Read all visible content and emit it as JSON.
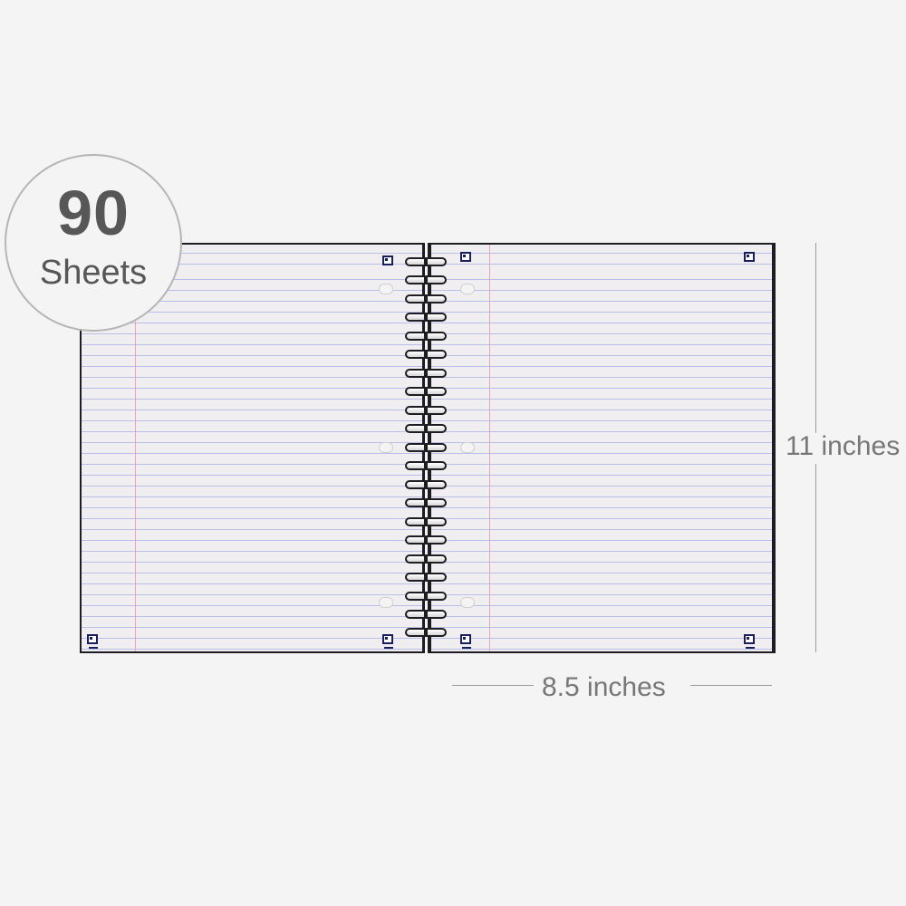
{
  "badge": {
    "count": "90",
    "unit": "Sheets"
  },
  "dimensions": {
    "height_label": "11 inches",
    "width_label": "8.5 inches"
  },
  "colors": {
    "background": "#f4f4f4",
    "paper": "#f1eef2",
    "rule_line": "#b9bfe6",
    "margin_line": "#e8a6b8",
    "cover_edge": "#1c1c22",
    "corner_mark": "#1a1f5c",
    "text": "#575757"
  },
  "icons": [
    "qr-corner-icon",
    "spiral-coil"
  ]
}
